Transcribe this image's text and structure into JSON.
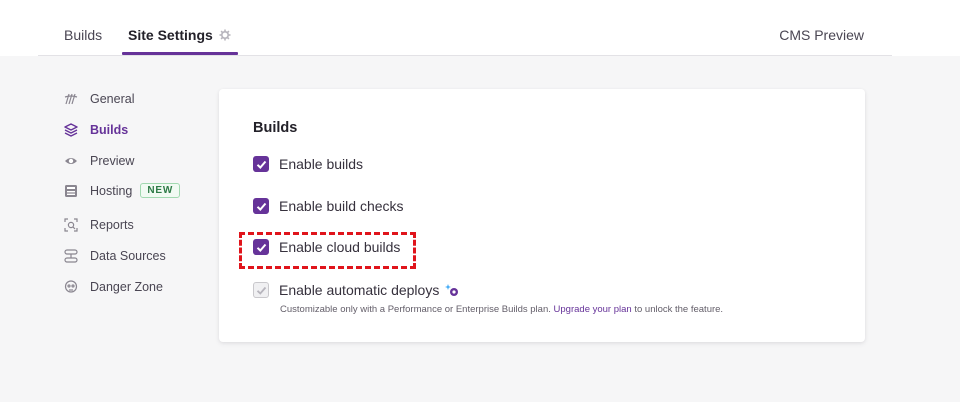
{
  "topnav": {
    "tabs": [
      {
        "label": "Builds"
      },
      {
        "label": "Site Settings"
      }
    ],
    "right_link": "CMS Preview",
    "active_color": "#663399"
  },
  "sidebar": {
    "items": [
      {
        "label": "General",
        "icon": "general-icon"
      },
      {
        "label": "Builds",
        "icon": "layers-icon",
        "active": true
      },
      {
        "label": "Preview",
        "icon": "eye-icon"
      },
      {
        "label": "Hosting",
        "icon": "hosting-icon",
        "badge": "NEW"
      },
      {
        "label": "Reports",
        "icon": "reports-icon"
      },
      {
        "label": "Data Sources",
        "icon": "data-sources-icon"
      },
      {
        "label": "Danger Zone",
        "icon": "danger-icon"
      }
    ]
  },
  "builds_card": {
    "title": "Builds",
    "options": [
      {
        "label": "Enable builds",
        "checked": true,
        "disabled": false
      },
      {
        "label": "Enable build checks",
        "checked": true,
        "disabled": false
      },
      {
        "label": "Enable cloud builds",
        "checked": true,
        "disabled": false
      },
      {
        "label": "Enable automatic deploys",
        "checked": true,
        "disabled": true
      }
    ],
    "helper_text_before": "Customizable only with a Performance or Enterprise Builds plan.",
    "helper_link": "Upgrade your plan",
    "helper_text_after": "to unlock the feature."
  }
}
